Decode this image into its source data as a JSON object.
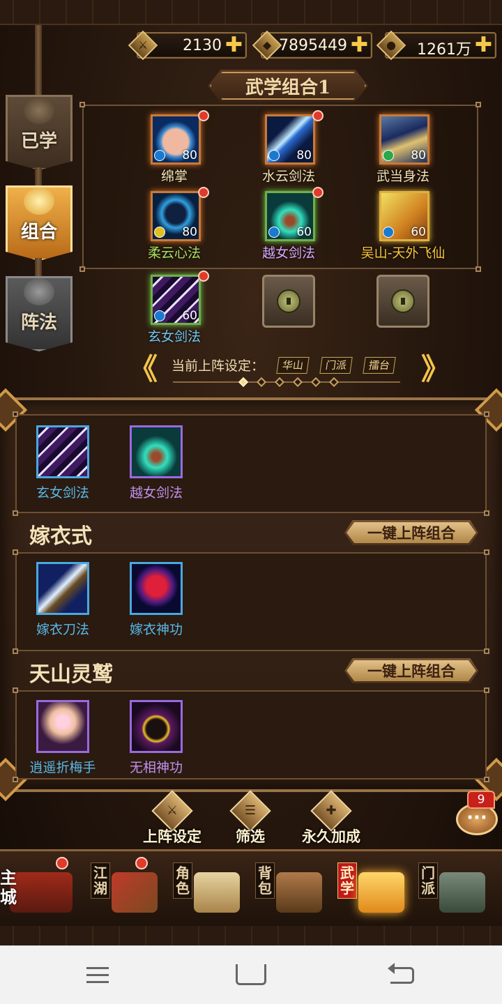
{
  "resources": [
    {
      "icon": "sword-icon",
      "value": "2130"
    },
    {
      "icon": "diamond-icon",
      "value": "7895449"
    },
    {
      "icon": "coin-icon",
      "value": "1261万"
    }
  ],
  "side_tabs": [
    {
      "label": "已学",
      "state": "inactive"
    },
    {
      "label": "组合",
      "state": "active"
    },
    {
      "label": "阵法",
      "state": "locked"
    }
  ],
  "combo_title": "武学组合1",
  "equipped_skills": [
    {
      "name": "绵掌",
      "level": "80",
      "icon": "palm-icon",
      "new": true
    },
    {
      "name": "水云剑法",
      "level": "80",
      "icon": "blue-sword-icon",
      "new": true
    },
    {
      "name": "武当身法",
      "level": "80",
      "icon": "body-technique-icon",
      "new": false
    },
    {
      "name": "柔云心法",
      "level": "80",
      "icon": "meditation-icon",
      "new": true
    },
    {
      "name": "越女剑法",
      "level": "60",
      "icon": "yuenv-sword-icon",
      "new": true
    },
    {
      "name": "吴山-天外飞仙",
      "level": "60",
      "icon": "flying-immortal-icon",
      "new": false
    },
    {
      "name": "玄女剑法",
      "level": "60",
      "icon": "xuannv-sword-icon",
      "new": true
    }
  ],
  "locked_slots": 2,
  "carousel": {
    "label": "当前上阵设定：",
    "tags": [
      "华山",
      "门派",
      "擂台"
    ],
    "page_count": 6,
    "active_page": 1
  },
  "sets": [
    {
      "title": "",
      "skills": [
        {
          "name": "玄女剑法",
          "icon": "xuannv-sword-icon",
          "color": "blue"
        },
        {
          "name": "越女剑法",
          "icon": "yuenv-sword-icon",
          "color": "purple"
        }
      ]
    },
    {
      "title": "嫁衣式",
      "button": "一键上阵组合",
      "skills": [
        {
          "name": "嫁衣刀法",
          "icon": "jiayi-blade-icon",
          "color": "blue"
        },
        {
          "name": "嫁衣神功",
          "icon": "jiayi-gong-icon",
          "color": "blue"
        }
      ]
    },
    {
      "title": "天山灵鹫",
      "button": "一键上阵组合",
      "skills": [
        {
          "name": "逍遥折梅手",
          "icon": "plum-hand-icon",
          "color": "blue"
        },
        {
          "name": "无相神功",
          "icon": "wuxiang-gong-icon",
          "color": "purple"
        }
      ]
    }
  ],
  "tools": [
    {
      "label": "上阵设定",
      "icon": "deploy-icon"
    },
    {
      "label": "筛选",
      "icon": "filter-icon"
    },
    {
      "label": "永久加成",
      "icon": "bonus-icon"
    }
  ],
  "chat": {
    "badge": "9",
    "icon": "chat-bubble-icon"
  },
  "nav": [
    {
      "label": "主城",
      "icon": "palace-icon",
      "dot": true,
      "active": false
    },
    {
      "label": "江湖",
      "icon": "flag-icon",
      "dot": true,
      "active": false
    },
    {
      "label": "角色",
      "icon": "scroll-icon",
      "dot": false,
      "active": false
    },
    {
      "label": "背包",
      "icon": "bag-icon",
      "dot": false,
      "active": false
    },
    {
      "label": "武学",
      "icon": "manual-icon",
      "dot": false,
      "active": true
    },
    {
      "label": "门派",
      "icon": "cauldron-icon",
      "dot": false,
      "active": false
    }
  ],
  "colors": {
    "accent_gold": "#f3c44a",
    "skill_blue": "#5ab8ea",
    "skill_purple": "#c290f0",
    "active_tab": "#f0b04a",
    "notify_red": "#e03a2a"
  }
}
